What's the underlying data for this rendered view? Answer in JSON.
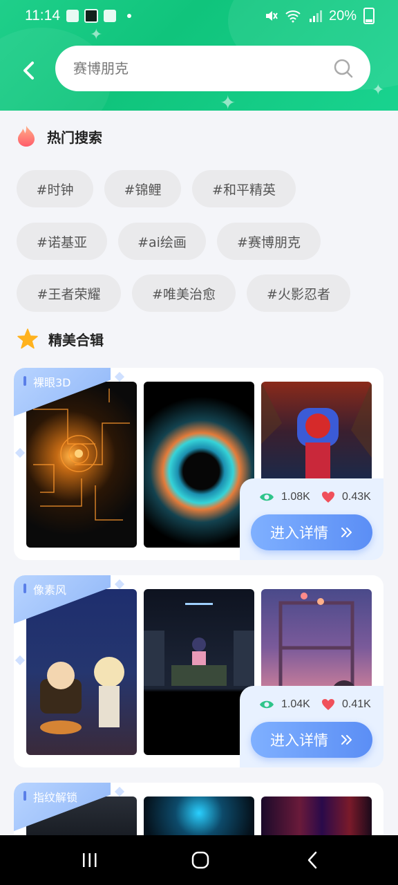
{
  "status_bar": {
    "time": "11:14",
    "battery": "20%"
  },
  "search": {
    "placeholder": "赛博朋克"
  },
  "hot_search": {
    "title": "热门搜索",
    "tags": [
      "#时钟",
      "#锦鲤",
      "#和平精英",
      "#诺基亚",
      "#ai绘画",
      "#赛博朋克",
      "#王者荣耀",
      "#唯美治愈",
      "#火影忍者"
    ]
  },
  "collections": {
    "title": "精美合辑",
    "items": [
      {
        "label": "裸眼3D",
        "views": "1.08K",
        "likes": "0.43K",
        "button": "进入详情"
      },
      {
        "label": "像素风",
        "views": "1.04K",
        "likes": "0.41K",
        "button": "进入详情"
      },
      {
        "label": "指纹解锁"
      }
    ]
  },
  "colors": {
    "header_green": "#14c882",
    "accent_blue": "#5b8ef5",
    "like_red": "#f0505a",
    "view_green": "#2fc48a"
  },
  "icons": [
    "back-arrow-icon",
    "search-icon",
    "flame-icon",
    "star-icon",
    "eye-icon",
    "heart-icon",
    "double-chevron-right-icon",
    "recents-icon",
    "home-icon",
    "back-icon"
  ]
}
